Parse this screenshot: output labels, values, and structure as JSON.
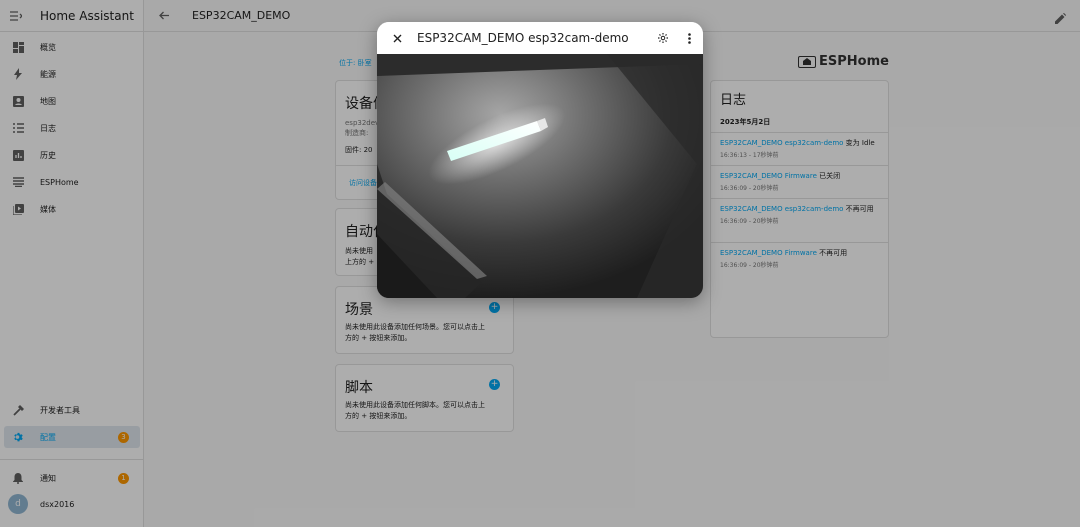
{
  "sidebar": {
    "title": "Home Assistant",
    "items": [
      {
        "label": "概览",
        "icon": "dashboard-icon"
      },
      {
        "label": "能源",
        "icon": "lightning-icon"
      },
      {
        "label": "地图",
        "icon": "map-account-icon"
      },
      {
        "label": "日志",
        "icon": "list-icon"
      },
      {
        "label": "历史",
        "icon": "chart-box-icon"
      },
      {
        "label": "ESPHome",
        "icon": "esphome-icon"
      },
      {
        "label": "媒体",
        "icon": "media-play-icon"
      }
    ],
    "dev_tools": {
      "label": "开发者工具",
      "icon": "hammer-icon"
    },
    "config": {
      "label": "配置",
      "icon": "gear-icon",
      "badge": "3"
    },
    "notifications": {
      "label": "通知",
      "icon": "bell-icon",
      "badge": "1"
    },
    "user": {
      "name": "dsx2016",
      "initial": "d"
    }
  },
  "topbar": {
    "title": "ESP32CAM_DEMO"
  },
  "main": {
    "breadcrumb": "位于: 卧室",
    "device_card": {
      "title": "设备信息",
      "model": "esp32dev",
      "manufacturer": "制造商:",
      "firmware": "固件: 20",
      "link": "访问设备"
    },
    "automation_card": {
      "title": "自动化",
      "text_line1": "尚未使用",
      "text_line2": "上方的 +"
    },
    "scene_card": {
      "title": "场景",
      "text_line1": "尚未使用此设备添加任何场景。您可以点击上",
      "text_line2": "方的 + 按钮来添加。"
    },
    "script_card": {
      "title": "脚本",
      "text_line1": "尚未使用此设备添加任何脚本。您可以点击上",
      "text_line2": "方的 + 按钮来添加。"
    },
    "esphome_brand": "ESPHome",
    "logbook": {
      "title": "日志",
      "date": "2023年5月2日",
      "entries": [
        {
          "entity": "ESP32CAM_DEMO esp32cam-demo",
          "action": " 变为 Idle",
          "time": "16:36:13 - 17秒钟前"
        },
        {
          "entity": "ESP32CAM_DEMO Firmware",
          "action": " 已关闭",
          "time": "16:36:09 - 20秒钟前"
        },
        {
          "entity": "ESP32CAM_DEMO esp32cam-demo",
          "action": " 不再可用",
          "time": "16:36:09 - 20秒钟前"
        },
        {
          "entity": "ESP32CAM_DEMO Firmware",
          "action": " 不再可用",
          "time": "16:36:09 - 20秒钟前"
        }
      ]
    }
  },
  "dialog": {
    "title": "ESP32CAM_DEMO esp32cam-demo",
    "close_icon": "close-icon",
    "settings_icon": "gear-icon",
    "more_icon": "dots-vertical-icon"
  },
  "colors": {
    "primary": "#03a9f4",
    "badge": "#ff9800",
    "active_bg": "#e0e8ef"
  }
}
